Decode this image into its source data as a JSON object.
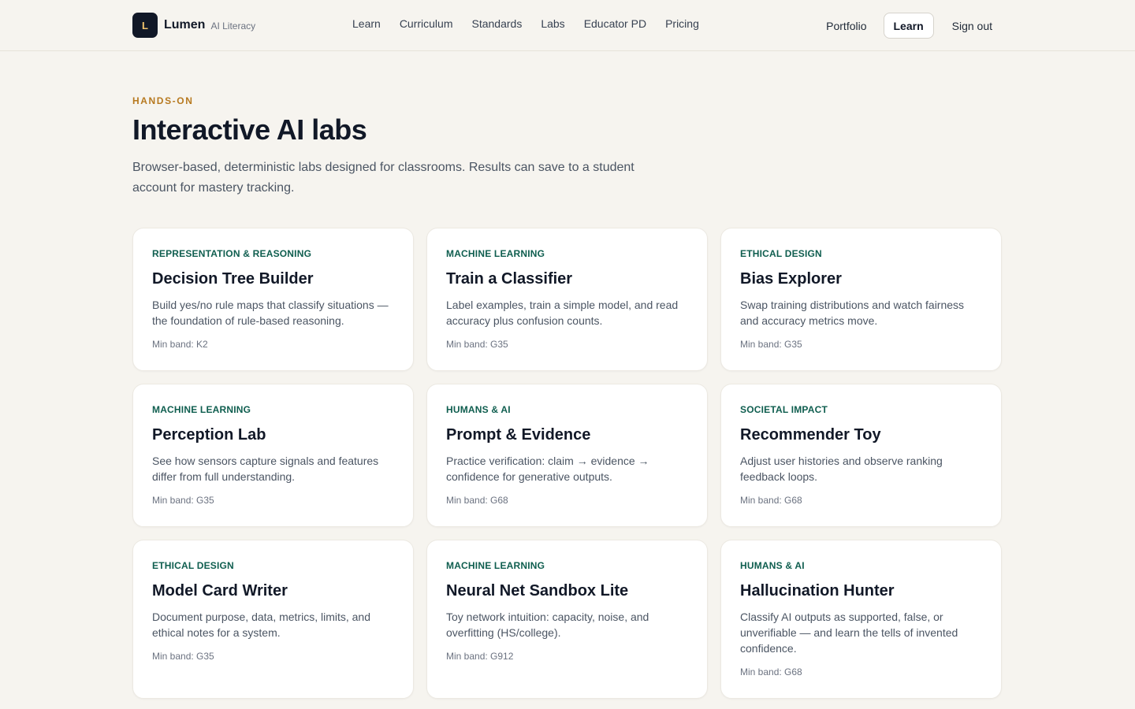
{
  "brand": {
    "mark": "L",
    "name": "Lumen",
    "subtitle": "AI Literacy"
  },
  "nav": {
    "items": [
      "Learn",
      "Curriculum",
      "Standards",
      "Labs",
      "Educator PD",
      "Pricing"
    ]
  },
  "account": {
    "portfolio": "Portfolio",
    "learn": "Learn",
    "sign_out": "Sign out"
  },
  "hero": {
    "eyebrow": "HANDS-ON",
    "title": "Interactive AI labs",
    "lead": "Browser-based, deterministic labs designed for classrooms. Results can save to a student account for mastery tracking."
  },
  "colors": {
    "accent": "#b7791f",
    "tag": "#0f5e4f",
    "background": "#f6f4ef"
  },
  "labs": [
    {
      "tag": "REPRESENTATION & REASONING",
      "title": "Decision Tree Builder",
      "desc": "Build yes/no rule maps that classify situations — the foundation of rule-based reasoning.",
      "band": "Min band: K2"
    },
    {
      "tag": "MACHINE LEARNING",
      "title": "Train a Classifier",
      "desc": "Label examples, train a simple model, and read accuracy plus confusion counts.",
      "band": "Min band: G35"
    },
    {
      "tag": "ETHICAL DESIGN",
      "title": "Bias Explorer",
      "desc": "Swap training distributions and watch fairness and accuracy metrics move.",
      "band": "Min band: G35"
    },
    {
      "tag": "MACHINE LEARNING",
      "title": "Perception Lab",
      "desc": "See how sensors capture signals and features differ from full understanding.",
      "band": "Min band: G35"
    },
    {
      "tag": "HUMANS & AI",
      "title": "Prompt & Evidence",
      "desc": "Practice verification: claim → evidence → confidence for generative outputs.",
      "band": "Min band: G68"
    },
    {
      "tag": "SOCIETAL IMPACT",
      "title": "Recommender Toy",
      "desc": "Adjust user histories and observe ranking feedback loops.",
      "band": "Min band: G68"
    },
    {
      "tag": "ETHICAL DESIGN",
      "title": "Model Card Writer",
      "desc": "Document purpose, data, metrics, limits, and ethical notes for a system.",
      "band": "Min band: G35"
    },
    {
      "tag": "MACHINE LEARNING",
      "title": "Neural Net Sandbox Lite",
      "desc": "Toy network intuition: capacity, noise, and overfitting (HS/college).",
      "band": "Min band: G912"
    },
    {
      "tag": "HUMANS & AI",
      "title": "Hallucination Hunter",
      "desc": "Classify AI outputs as supported, false, or unverifiable — and learn the tells of invented confidence.",
      "band": "Min band: G68"
    }
  ]
}
